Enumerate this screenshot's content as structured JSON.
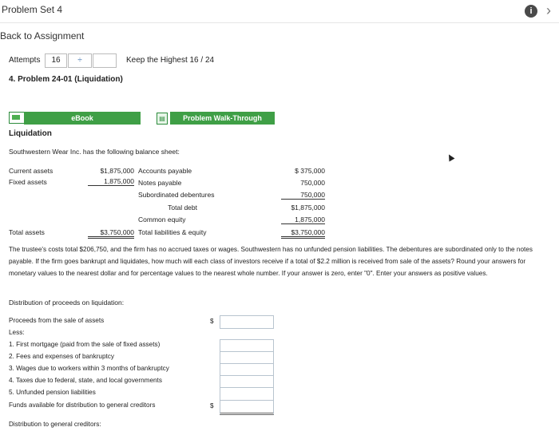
{
  "header": {
    "title": "Problem Set 4"
  },
  "nav": {
    "back_label": "Back to Assignment"
  },
  "attempts": {
    "label": "Attempts",
    "value": "16",
    "stepper_glyph": "÷",
    "keep_label": "Keep the Highest 16 / 24"
  },
  "problem": {
    "title": "4. Problem 24-01 (Liquidation)"
  },
  "buttons": {
    "ebook": "eBook",
    "walkthrough": "Problem Walk-Through"
  },
  "section": {
    "heading": "Liquidation",
    "intro": "Southwestern Wear Inc. has the following balance sheet:"
  },
  "balance_sheet": {
    "current_assets_label": "Current assets",
    "current_assets_value": "$1,875,000",
    "fixed_assets_label": "Fixed assets",
    "fixed_assets_value": "1,875,000",
    "total_assets_label": "Total assets",
    "total_assets_value": "$3,750,000",
    "liabilities": [
      {
        "label": "Accounts payable",
        "value": "$ 375,000"
      },
      {
        "label": "Notes payable",
        "value": "750,000"
      },
      {
        "label": "Subordinated debentures",
        "value": "750,000"
      },
      {
        "label": "Total debt",
        "value": "$1,875,000"
      },
      {
        "label": "Common equity",
        "value": "1,875,000"
      },
      {
        "label": "Total liabilities & equity",
        "value": "$3,750,000"
      }
    ]
  },
  "instructions": "The trustee's costs total $206,750, and the firm has no accrued taxes or wages. Southwestern has no unfunded pension liabilities. The debentures are subordinated only to the notes payable. If the firm goes bankrupt and liquidates, how much will each class of investors receive if a total of $2.2 million is received from sale of the assets? Round your answers for monetary values to the nearest dollar and for percentage values to the nearest whole number. If your answer is zero, enter \"0\". Enter your answers as positive values.",
  "distribution": {
    "label": "Distribution of proceeds on liquidation:",
    "proceeds_label": "Proceeds from the sale of assets",
    "less_label": "Less:",
    "items": [
      "1. First mortgage (paid from the sale of fixed assets)",
      "2. Fees and expenses of bankruptcy",
      "3. Wages due to workers within 3 months of bankruptcy",
      "4. Taxes due to federal, state, and local governments",
      "5. Unfunded pension liabilities"
    ],
    "funds_label": "Funds available for distribution to general creditors",
    "dollar_sign": "$",
    "general_creditors_label": "Distribution to general creditors:"
  }
}
